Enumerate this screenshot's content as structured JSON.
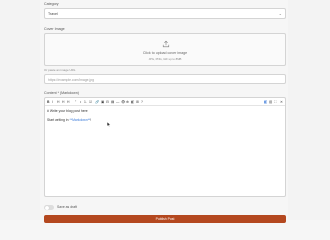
{
  "form": {
    "category_label": "Category",
    "category_value": "Travel",
    "cover_label": "Cover Image",
    "cover_upload_text": "Click to upload cover image",
    "cover_upload_hint": "JPG, PNG, GIF up to 8MB",
    "paste_hint": "Or paste an image URL",
    "url_placeholder": "https://example.com/image.jpg",
    "content_label": "Content * (Markdown)",
    "content_line1": "# Write your blog post here",
    "content_line2_prefix": "Start writing in ",
    "content_line2_code": "**Markdown**",
    "content_line2_suffix": "!",
    "draft_label": "Save as draft",
    "submit_label": "Publish Post"
  },
  "toolbar": {
    "left": [
      "B",
      "I",
      "H",
      "H",
      "H",
      "\"",
      "•",
      "1.",
      "☑",
      "🔗",
      "▣",
      "⊟",
      "▤",
      "—",
      "👁",
      "⊕",
      "◧",
      "⊞",
      "?"
    ],
    "right": [
      "◧",
      "▥",
      "⛶",
      "✕"
    ]
  },
  "colors": {
    "accent": "#3b7bd9",
    "submit": "#b4481f"
  }
}
